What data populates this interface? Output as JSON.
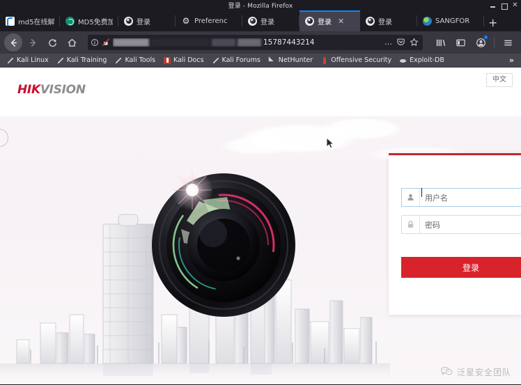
{
  "window": {
    "title": "登录 - Mozilla Firefox",
    "controls": {
      "minimize": "minimize-button",
      "maximize": "maximize-button",
      "close": "✕"
    }
  },
  "browser": {
    "tabs": [
      {
        "title": "md5在线解",
        "favicon": "md5-online-icon",
        "active": false
      },
      {
        "title": "MD5免费加",
        "favicon": "md5-free-icon",
        "active": false
      },
      {
        "title": "登录",
        "favicon": "hikvision-icon",
        "active": false
      },
      {
        "title": "Preferenc",
        "favicon": "gear-icon",
        "active": false
      },
      {
        "title": "登录",
        "favicon": "hikvision-icon",
        "active": false
      },
      {
        "title": "登录",
        "favicon": "hikvision-icon",
        "active": true,
        "close": "✕"
      },
      {
        "title": "登录",
        "favicon": "hikvision-icon",
        "active": false
      },
      {
        "title": "SANGFOR",
        "favicon": "sangfor-icon",
        "active": false
      }
    ],
    "new_tab_label": "+",
    "nav": {
      "back": "back-arrow-icon",
      "forward": "forward-arrow-icon",
      "reload": "reload-icon",
      "home": "home-icon"
    },
    "urlbar": {
      "identity_icon": "info-circle-icon",
      "pencil_icon": "broken-lock-icon",
      "url_visible_tail": "15787443214",
      "redacted": true,
      "page_actions": "…",
      "pocket_icon": "pocket-icon",
      "bookmark_icon": "star-icon"
    },
    "toolbar_right": {
      "library": "library-icon",
      "sidebar": "sidebar-icon",
      "account": "account-icon",
      "menu": "hamburger-menu-icon"
    },
    "bookmarks": [
      {
        "label": "Kali Linux",
        "icon": "kali-dragon-icon"
      },
      {
        "label": "Kali Training",
        "icon": "kali-dragon-icon"
      },
      {
        "label": "Kali Tools",
        "icon": "kali-dragon-icon"
      },
      {
        "label": "Kali Docs",
        "icon": "kali-docs-icon"
      },
      {
        "label": "Kali Forums",
        "icon": "kali-dragon-icon"
      },
      {
        "label": "NetHunter",
        "icon": "nethunter-icon"
      },
      {
        "label": "Offensive Security",
        "icon": "offensive-security-icon"
      },
      {
        "label": "Exploit-DB",
        "icon": "exploit-db-icon"
      }
    ],
    "bookmarks_overflow": "»"
  },
  "page": {
    "brand": {
      "part_red": "HIK",
      "part_gray": "VISION"
    },
    "language_button": "中文",
    "login": {
      "username_placeholder": "用户名",
      "password_placeholder": "密码",
      "submit_label": "登录",
      "username_icon": "user-icon",
      "password_icon": "lock-icon"
    },
    "watermark": {
      "text": "泛星安全团队",
      "icon": "wechat-icon"
    }
  },
  "colors": {
    "brand_red": "#c8102e",
    "button_red": "#d8232a",
    "panel_border_red": "#c1272d",
    "focus_blue": "#a8cdeb",
    "chrome_dark": "#1c1b22",
    "toolbar": "#38373f",
    "bookmarks_bar": "#47464f"
  }
}
